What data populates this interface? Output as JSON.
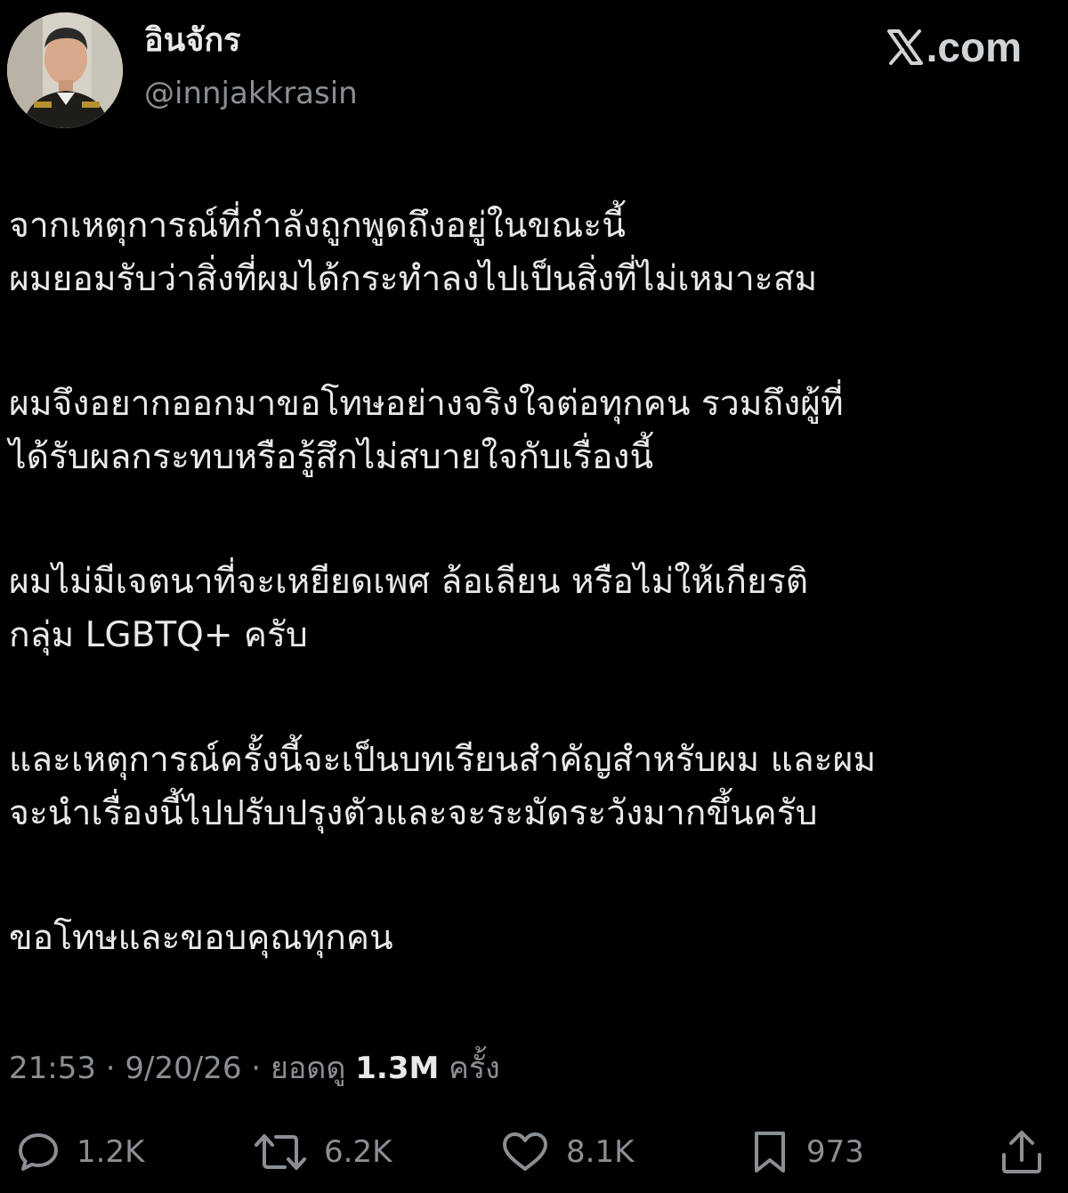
{
  "profile": {
    "display_name": "อินจักร",
    "handle": "@innjakkrasin",
    "avatar_icon": "profile-photo"
  },
  "brand": {
    "label": ".com",
    "icon": "x-logo"
  },
  "post": {
    "paragraphs": [
      {
        "lines": [
          "จากเหตุการณ์ที่กำลังถูกพูดถึงอยู่ในขณะนี้",
          "ผมยอมรับว่าสิ่งที่ผมได้กระทำลงไปเป็นสิ่งที่ไม่เหมาะสม"
        ]
      },
      {
        "lines": [
          "ผมจึงอยากออกมาขอโทษอย่างจริงใจต่อทุกคน รวมถึงผู้ที่",
          "ได้รับผลกระทบหรือรู้สึกไม่สบายใจกับเรื่องนี้"
        ]
      },
      {
        "lines": [
          "ผมไม่มีเจตนาที่จะเหยียดเพศ ล้อเลียน หรือไม่ให้เกียรติ",
          "กลุ่ม LGBTQ+ ครับ"
        ]
      },
      {
        "lines": [
          "และเหตุการณ์ครั้งนี้จะเป็นบทเรียนสำคัญสำหรับผม และผม",
          "จะนำเรื่องนี้ไปปรับปรุงตัวและจะระมัดระวังมากขึ้นครับ"
        ]
      },
      {
        "lines": [
          "ขอโทษและขอบคุณทุกคน"
        ]
      }
    ]
  },
  "meta": {
    "time": "21:53",
    "separator": " · ",
    "date": "9/20/26",
    "views_label": "ยอดดู",
    "views_count": "1.3M",
    "views_suffix": "ครั้ง"
  },
  "actions": {
    "reply": {
      "count": "1.2K",
      "icon": "reply-icon"
    },
    "repost": {
      "count": "6.2K",
      "icon": "repost-icon"
    },
    "like": {
      "count": "8.1K",
      "icon": "heart-icon"
    },
    "bookmark": {
      "count": "973",
      "icon": "bookmark-icon"
    },
    "share": {
      "icon": "share-icon"
    }
  },
  "colors": {
    "background": "#000000",
    "text_primary": "#e7e9ea",
    "text_secondary": "#8b8f94"
  }
}
